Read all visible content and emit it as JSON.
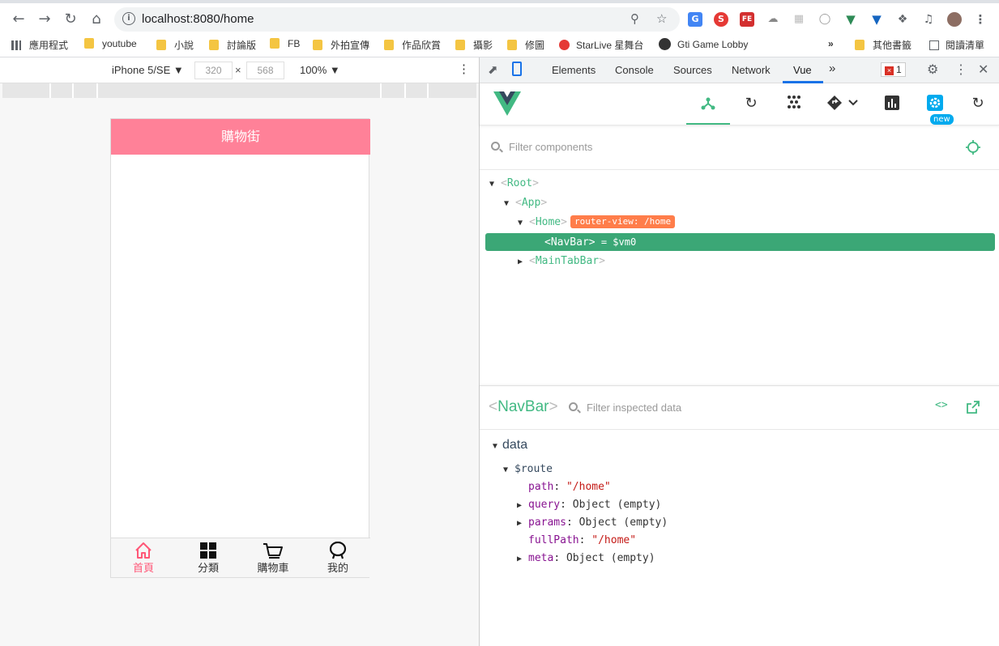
{
  "browser": {
    "url": "localhost:8080/home",
    "bookmarks": [
      "應用程式",
      "youtube",
      "小說",
      "討論版",
      "FB",
      "外拍宣傳",
      "作品欣賞",
      "攝影",
      "修圖",
      "StarLive 星舞台",
      "Gti Game Lobby",
      "其他書籤",
      "閱讀清單"
    ],
    "bookmarks_overflow": "»"
  },
  "device_toolbar": {
    "device": "iPhone 5/SE ▼",
    "width": "320",
    "times": "×",
    "height": "568",
    "zoom": "100% ▼"
  },
  "app": {
    "nav_title": "購物街",
    "tabs": [
      {
        "label": "首頁",
        "icon": "home-icon"
      },
      {
        "label": "分類",
        "icon": "grid-icon"
      },
      {
        "label": "購物車",
        "icon": "cart-icon"
      },
      {
        "label": "我的",
        "icon": "profile-icon"
      }
    ],
    "active_tab": 0
  },
  "devtools": {
    "tabs": [
      "Elements",
      "Console",
      "Sources",
      "Network",
      "Vue"
    ],
    "active_tab": "Vue",
    "more": "»",
    "error_count": "1",
    "new_badge": "new"
  },
  "vue": {
    "filter_placeholder": "Filter components",
    "tree": [
      {
        "lt": "<",
        "name": "Root",
        "gt": ">",
        "expanded": true
      },
      {
        "lt": "<",
        "name": "App",
        "gt": ">",
        "expanded": true
      },
      {
        "lt": "<",
        "name": "Home",
        "gt": ">",
        "badge": "router-view: /home",
        "expanded": true
      },
      {
        "lt": "<",
        "name": "NavBar",
        "gt": ">",
        "suffix": " = $vm0",
        "selected": true
      },
      {
        "lt": "<",
        "name": "MainTabBar",
        "gt": ">",
        "expanded": false
      }
    ],
    "inspector": {
      "lt": "<",
      "name": "NavBar",
      "gt": ">",
      "filter_placeholder": "Filter inspected data",
      "section": "data",
      "route_key": "$route",
      "fields": [
        {
          "key": "path",
          "sep": ": ",
          "value": "\"/home\"",
          "kind": "string",
          "expandable": false
        },
        {
          "key": "query",
          "sep": ": ",
          "value": "Object (empty)",
          "kind": "object",
          "expandable": true
        },
        {
          "key": "params",
          "sep": ": ",
          "value": "Object (empty)",
          "kind": "object",
          "expandable": true
        },
        {
          "key": "fullPath",
          "sep": ": ",
          "value": "\"/home\"",
          "kind": "string",
          "expandable": false
        },
        {
          "key": "meta",
          "sep": ": ",
          "value": "Object (empty)",
          "kind": "object",
          "expandable": true
        }
      ]
    }
  },
  "colors": {
    "vue_green": "#42b983",
    "selected_row": "#3ba776",
    "router_badge": "#ff7d4a",
    "app_nav": "#ff8198",
    "active_tab": "#ff5777"
  }
}
